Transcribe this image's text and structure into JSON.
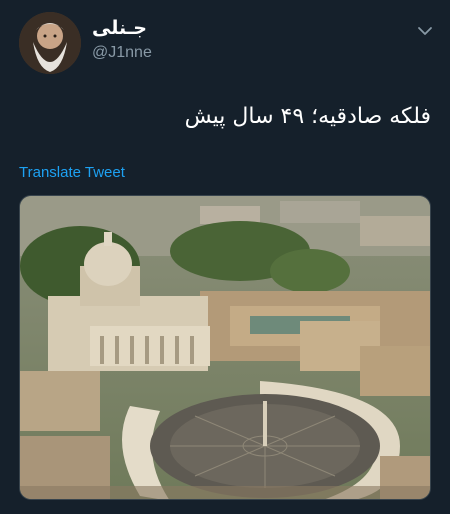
{
  "tweet": {
    "display_name": "جـنلی",
    "handle": "@J1nne",
    "text": "فلکه صادقیه؛ ۴۹ سال پیش",
    "translate_label": "Translate Tweet"
  },
  "icons": {
    "menu": "chevron-down-icon"
  },
  "colors": {
    "background": "#15202b",
    "secondary_text": "#8899a6",
    "link": "#1da1f2"
  }
}
